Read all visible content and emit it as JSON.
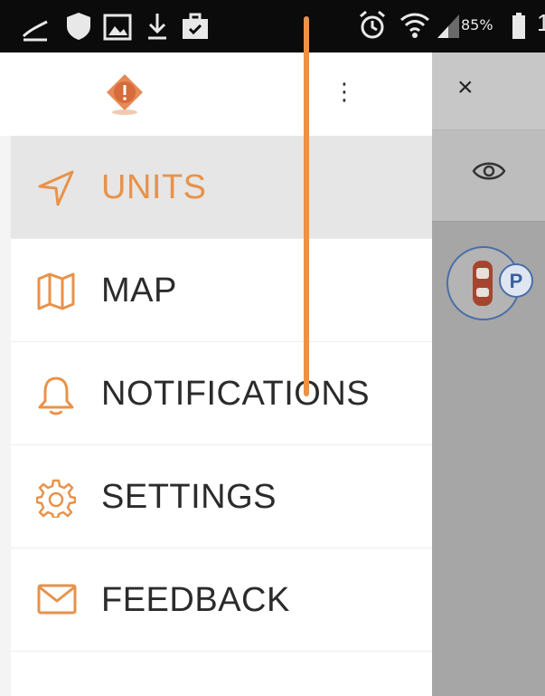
{
  "status_bar": {
    "battery_percent": "85%",
    "clock_partial": "1",
    "left_icons": [
      "cast-icon",
      "shield-icon",
      "image-icon",
      "download-icon",
      "briefcase-icon"
    ],
    "right_icons": [
      "alarm-icon",
      "wifi-icon",
      "signal-icon",
      "battery-icon"
    ]
  },
  "drawer": {
    "header": {
      "logo": "pin-logo-icon",
      "menu_glyph": "⋮"
    },
    "items": [
      {
        "id": "units",
        "label": "UNITS",
        "icon": "navigation-arrow-icon",
        "active": true
      },
      {
        "id": "map",
        "label": "MAP",
        "icon": "map-icon",
        "active": false
      },
      {
        "id": "notifications",
        "label": "NOTIFICATIONS",
        "icon": "bell-icon",
        "active": false
      },
      {
        "id": "settings",
        "label": "SETTINGS",
        "icon": "gear-icon",
        "active": false
      },
      {
        "id": "feedback",
        "label": "FEEDBACK",
        "icon": "envelope-icon",
        "active": false
      }
    ]
  },
  "background_panel": {
    "close_glyph": "×",
    "icons": [
      "eye-icon",
      "car-icon",
      "parking-icon"
    ],
    "parking_letter": "P"
  },
  "colors": {
    "accent": "#e8924a",
    "status_bar": "#0b0b0b",
    "active_row": "#e6e6e6",
    "dim_overlay": "#a6a6a6"
  }
}
